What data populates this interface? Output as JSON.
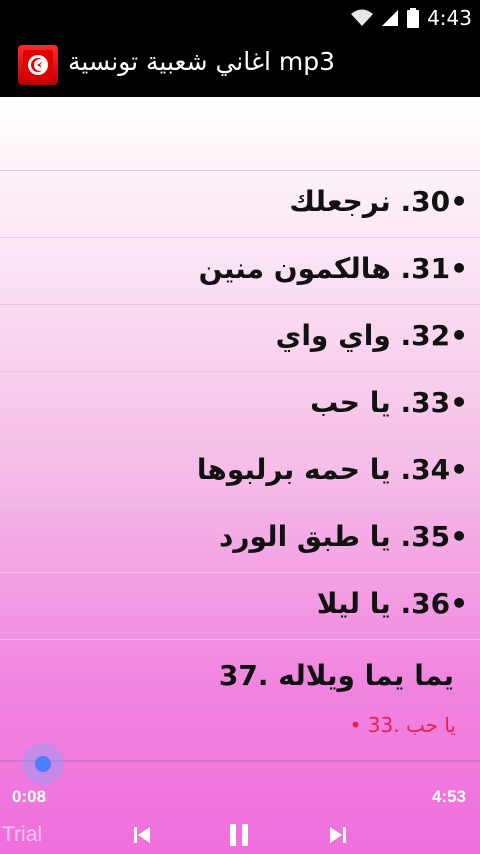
{
  "status_bar": {
    "time": "4:43"
  },
  "app": {
    "title": "اغاني شعبية تونسية mp3"
  },
  "songs": [
    {
      "label": "•30. نرجعلك"
    },
    {
      "label": "•31. هالكمون منين"
    },
    {
      "label": "•32. واي واي"
    },
    {
      "label": "•33. يا حب"
    },
    {
      "label": "•34. يا حمه برلبوها"
    },
    {
      "label": "•35. يا طبق الورد"
    },
    {
      "label": "•36. يا ليلا"
    }
  ],
  "player": {
    "current_title": "يما يما ويلاله .37",
    "current_sub": "• 33. يا حب",
    "elapsed": "0:08",
    "duration": "4:53",
    "progress_fraction": 0.027,
    "watermark": "Trial"
  }
}
